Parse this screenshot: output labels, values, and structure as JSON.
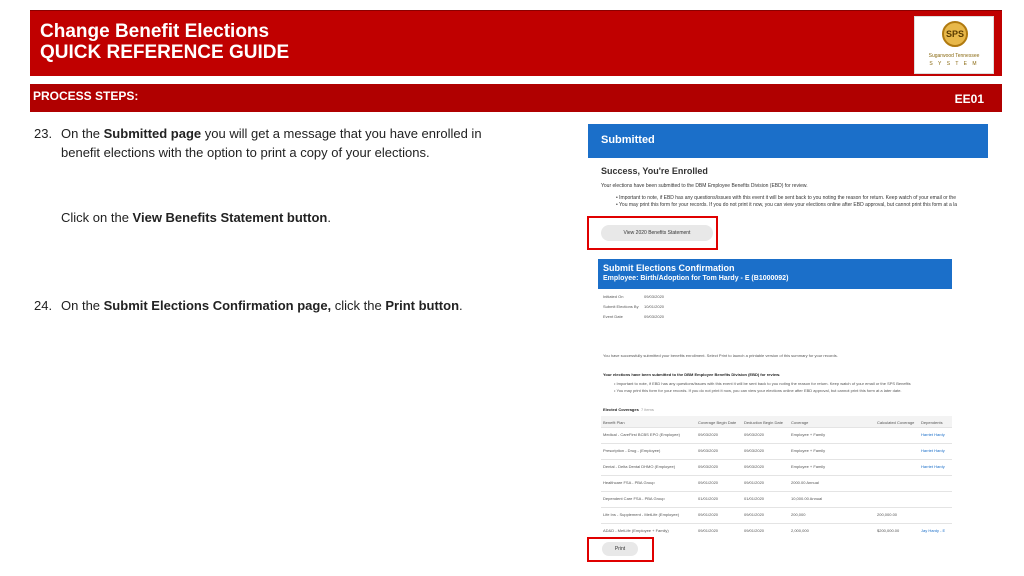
{
  "header": {
    "title_line1": "Change Benefit Elections",
    "title_line2": "QUICK REFERENCE GUIDE",
    "logo_seal": "SPS",
    "logo_line1": "Sugarwood Tennessee",
    "logo_line2": "S Y S T E M"
  },
  "steps_bar": {
    "label": "PROCESS STEPS:",
    "code": "EE01"
  },
  "steps": {
    "s23_num": "23.",
    "s23_a": "On the ",
    "s23_b": "Submitted page",
    "s23_c": " you will get a message that you have enrolled in",
    "s23_d": "benefit elections with the option to print a copy of your elections.",
    "click_a": "Click on the ",
    "click_b": "View Benefits Statement button",
    "click_c": ".",
    "s24_num": "24.",
    "s24_a": "On the ",
    "s24_b": "Submit Elections Confirmation page,",
    "s24_c": " click the ",
    "s24_d": "Print button",
    "s24_e": "."
  },
  "shot1": {
    "bar_title": "Submitted",
    "heading": "Success, You're Enrolled",
    "para": "Your elections have been submitted to the DBM Employee Benefits Division (EBD) for review.",
    "bullet1": "• Important to note, if EBD has any questions/issues with this event it will be sent back to you noting the reason for return. Keep watch of your email or the",
    "bullet2": "• You may print this form for your records. If you do not print it now, you can view your elections online after EBD approval, but cannot print this form at a la",
    "button": "View 2020 Benefits Statement"
  },
  "shot2": {
    "bar_title": "Submit Elections Confirmation",
    "bar_sub": "Employee: Birth/Adoption for Tom Hardy - E (B1000092)",
    "init_label": "Initiated On",
    "init_val": "09/03/2020",
    "sub_label": "Submit Elections By",
    "sub_val": "10/01/2020",
    "event_label": "Event Date",
    "event_val": "09/03/2020",
    "success_msg": "You have successfully submitted your benefits enrollment. Select Print to launch a printable version of this summary for your records.",
    "review": "Your elections have been submitted to the DBM Employee Benefits Division (EBD) for review.",
    "b1": "• Important to note, if EBD has any questions/issues with this event it will be sent back to you noting the reason for return. Keep watch of your email or the SPS Benefits",
    "b2": "• You may print this form for your records. If you do not print it now, you can view your elections online after EBD approval, but cannot print this form at a later date.",
    "table_title": "Elected Coverages",
    "table_count": "7 items",
    "headers": [
      "Benefit Plan",
      "Coverage Begin Date",
      "Deduction Begin Date",
      "Coverage",
      "Calculated Coverage",
      "Dependents"
    ],
    "rows": [
      [
        "Medical - CareFirst BCBS EPO (Employee)",
        "09/03/2020",
        "09/03/2020",
        "Employee + Family",
        "",
        "Harriet Hardy"
      ],
      [
        "Prescription - Drug - (Employee)",
        "09/03/2020",
        "09/03/2020",
        "Employee + Family",
        "",
        "Harriet Hardy"
      ],
      [
        "Dental - Delta Dental DHMO (Employee)",
        "09/03/2020",
        "09/03/2020",
        "Employee + Family",
        "",
        "Harriet Hardy"
      ],
      [
        "Healthcare FSA - PBA Group",
        "09/01/2020",
        "09/01/2020",
        "2000.00 Annual",
        "",
        ""
      ],
      [
        "Dependent Care FSA - PBA Group",
        "01/01/2020",
        "01/01/2020",
        "10,000.00 Annual",
        "",
        ""
      ],
      [
        "Life Ins - Supplement - MetLife (Employee)",
        "09/01/2020",
        "09/01/2020",
        "200,000",
        "200,000.00",
        ""
      ],
      [
        "AD&D - MetLife (Employee + Family)",
        "09/01/2020",
        "09/01/2020",
        "2,000,000",
        "$200,000.00",
        "Jay Hardy - E"
      ]
    ],
    "print_button": "Print"
  }
}
